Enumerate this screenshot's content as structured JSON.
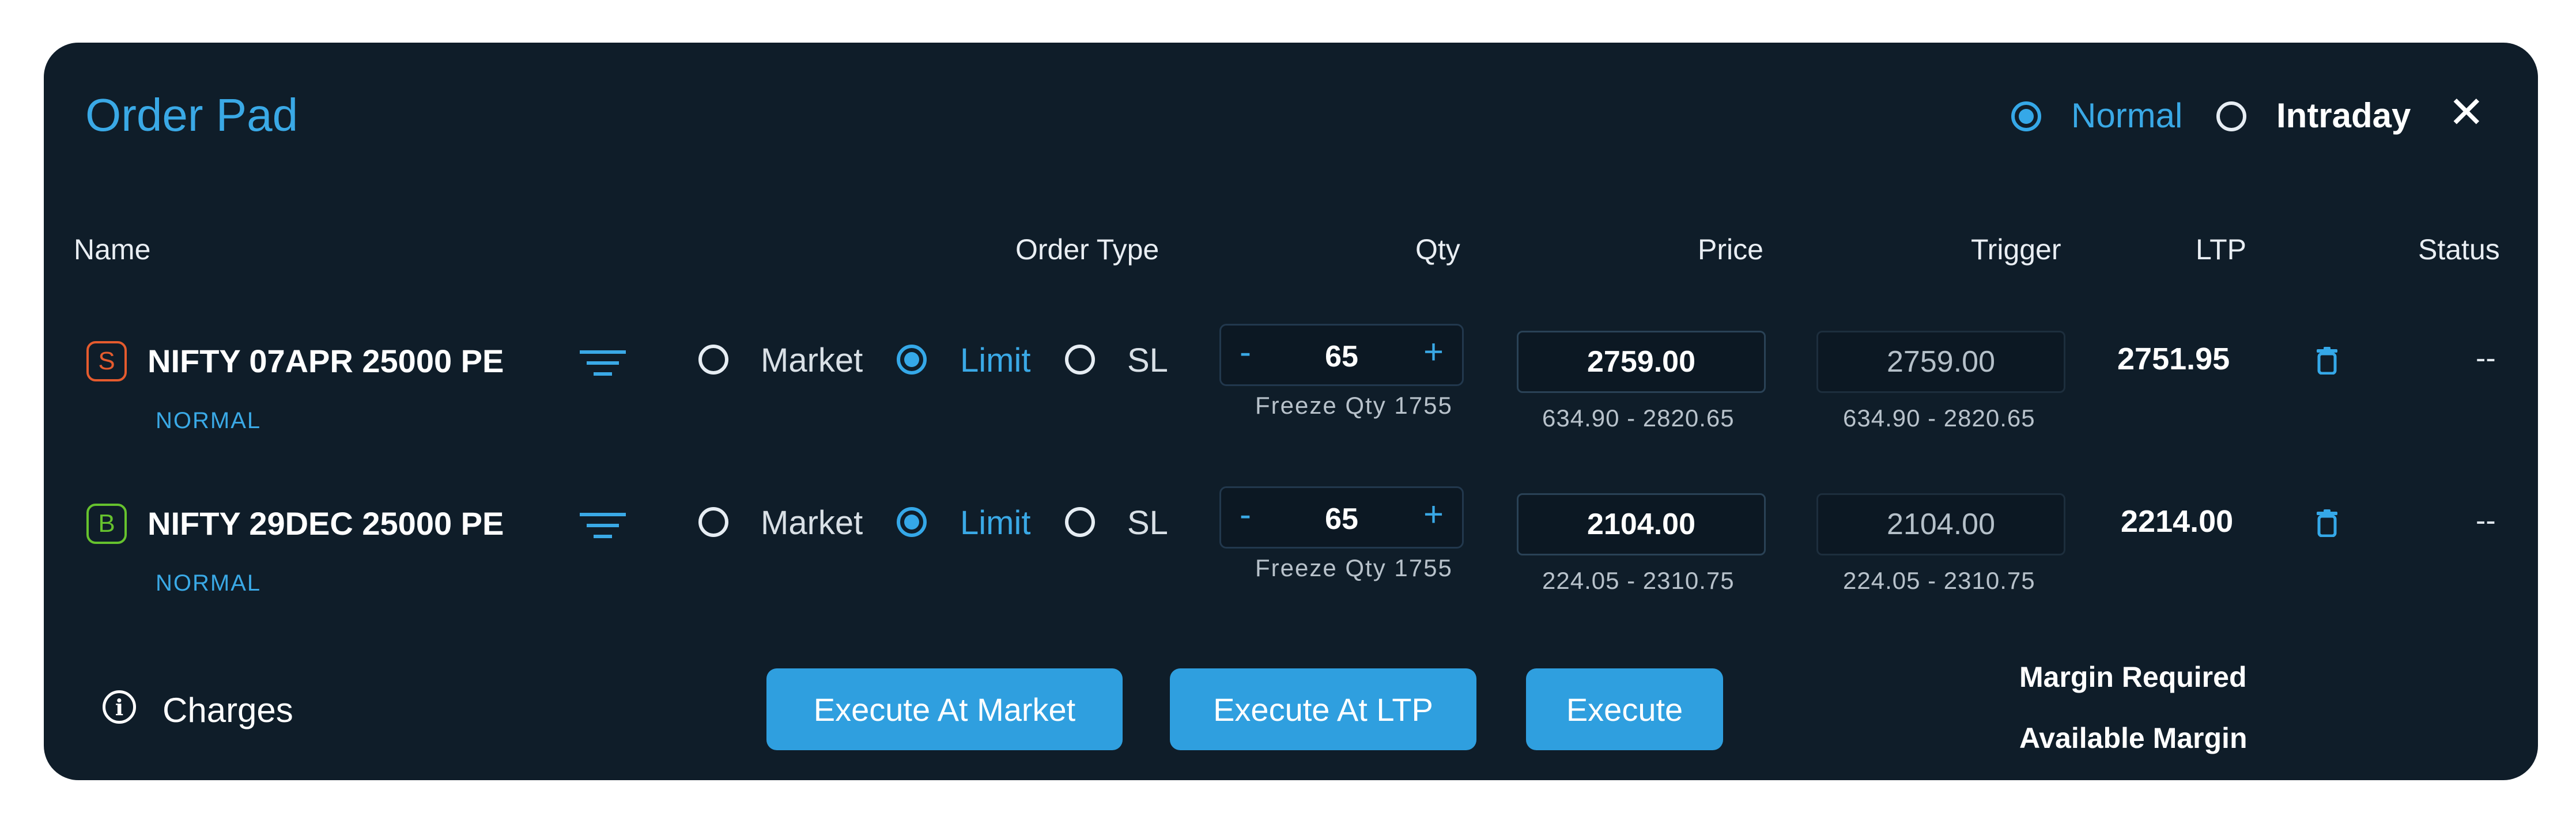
{
  "header": {
    "title": "Order Pad",
    "product_options": [
      {
        "label": "Normal",
        "selected": true
      },
      {
        "label": "Intraday",
        "selected": false
      }
    ],
    "close_symbol": "✕"
  },
  "columns": [
    "Name",
    "Order Type",
    "Qty",
    "Price",
    "Trigger",
    "LTP",
    "Status"
  ],
  "rows": [
    {
      "side": "S",
      "side_color": "#e55b2e",
      "symbol": "NIFTY 07APR 25000 PE",
      "product": "NORMAL",
      "order_types": [
        "Market",
        "Limit",
        "SL"
      ],
      "selected_order_type": "Limit",
      "qty": "65",
      "freeze_qty": "Freeze Qty 1755",
      "price": "2759.00",
      "price_range": "634.90 - 2820.65",
      "trigger": "2759.00",
      "trigger_range": "634.90 - 2820.65",
      "ltp": "2751.95",
      "status": "--"
    },
    {
      "side": "B",
      "side_color": "#66c22e",
      "symbol": "NIFTY 29DEC 25000 PE",
      "product": "NORMAL",
      "order_types": [
        "Market",
        "Limit",
        "SL"
      ],
      "selected_order_type": "Limit",
      "qty": "65",
      "freeze_qty": "Freeze Qty 1755",
      "price": "2104.00",
      "price_range": "224.05 - 2310.75",
      "trigger": "2104.00",
      "trigger_range": "224.05 - 2310.75",
      "ltp": "2214.00",
      "status": "--"
    }
  ],
  "qty_controls": {
    "minus": "-",
    "plus": "+"
  },
  "footer": {
    "charges_icon": "i",
    "charges_label": "Charges",
    "buttons": [
      "Execute At Market",
      "Execute At LTP",
      "Execute"
    ],
    "margin_required_label": "Margin Required",
    "available_margin_label": "Available Margin"
  },
  "colors": {
    "background": "#0f1d29",
    "accent": "#3aa9e6",
    "button": "#2f9fdf"
  },
  "icons": [
    "info-icon",
    "filter-icon",
    "trash-icon",
    "close-icon"
  ]
}
